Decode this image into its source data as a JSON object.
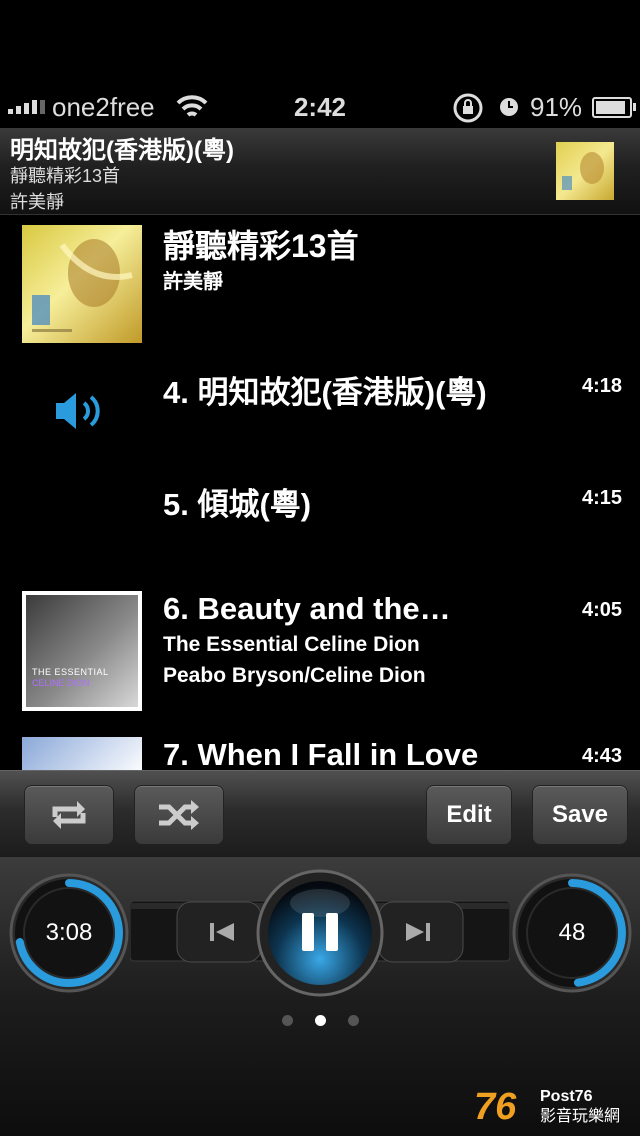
{
  "status_bar": {
    "carrier": "one2free",
    "time": "2:42",
    "battery": "91%",
    "battery_level": 0.91
  },
  "now_playing": {
    "song": "明知故犯(香港版)(粵)",
    "album": "靜聽精彩13首",
    "artist": "許美靜"
  },
  "album_section": {
    "title": "靜聽精彩13首",
    "artist": "許美靜"
  },
  "tracks": [
    {
      "title": "4. 明知故犯(香港版)(粵)",
      "duration": "4:18",
      "playing": true
    },
    {
      "title": "5. 傾城(粵)",
      "duration": "4:15"
    },
    {
      "title": "6. Beauty and the…",
      "duration": "4:05",
      "album": "The Essential Celine Dion",
      "artist": "Peabo Bryson/Celine Dion"
    },
    {
      "title": "7. When I Fall in Love",
      "duration": "4:43"
    }
  ],
  "thumb_text": {
    "line1": "THE ESSENTIAL",
    "line2": "CELINE DION"
  },
  "toolbar": {
    "repeat_icon": "repeat-icon",
    "shuffle_icon": "shuffle-icon",
    "edit_label": "Edit",
    "save_label": "Save"
  },
  "player": {
    "elapsed": "3:08",
    "elapsed_progress": 0.72,
    "volume": "48",
    "volume_level": 0.48,
    "prev_icon": "previous-icon",
    "pause_icon": "pause-icon",
    "next_icon": "next-icon",
    "page_count": 3,
    "current_page": 1
  },
  "watermark": {
    "brand": "Post76",
    "tagline": "影音玩樂網"
  },
  "colors": {
    "accent": "#2a9bdc",
    "background": "#000000"
  }
}
